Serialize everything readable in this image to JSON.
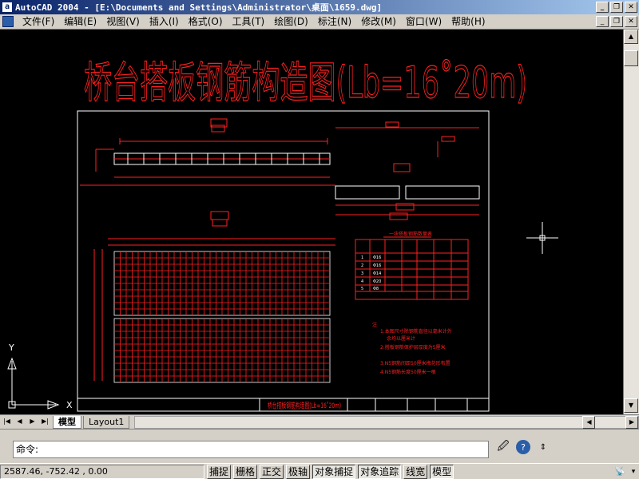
{
  "window": {
    "title": "AutoCAD 2004 - [E:\\Documents and Settings\\Administrator\\桌面\\1659.dwg]",
    "app_icon": "autocad-icon"
  },
  "menu": [
    {
      "label": "文件(F)"
    },
    {
      "label": "编辑(E)"
    },
    {
      "label": "视图(V)"
    },
    {
      "label": "插入(I)"
    },
    {
      "label": "格式(O)"
    },
    {
      "label": "工具(T)"
    },
    {
      "label": "绘图(D)"
    },
    {
      "label": "标注(N)"
    },
    {
      "label": "修改(M)"
    },
    {
      "label": "窗口(W)"
    },
    {
      "label": "帮助(H)"
    }
  ],
  "drawing": {
    "big_title": "桥台搭板钢筋构造图(Lb=16˚20m)",
    "frame_title": "桥台搭板钢筋构造图(Lb=16˚20m)",
    "table_title": "一块搭板钢筋数量表",
    "notes": [
      "注",
      "1.本图尺寸除钢筋直径以毫米计外",
      "余均以厘米计",
      "2.搭板钢筋保护层厚度为5厘米",
      "3.N5钢筋间距50厘米梅花形布置",
      "4.N5钢筋长度50厘米一根"
    ],
    "table_rows": [
      {
        "no": "1",
        "d": "Φ16"
      },
      {
        "no": "2",
        "d": "Φ16"
      },
      {
        "no": "3",
        "d": "Φ14"
      },
      {
        "no": "4",
        "d": "Φ20"
      },
      {
        "no": "5",
        "d": "Φ8"
      }
    ],
    "ucs_y": "Y",
    "ucs_x": "X"
  },
  "tabs": {
    "model": "模型",
    "layout1": "Layout1"
  },
  "command": {
    "prompt": "命令:"
  },
  "status": {
    "coords": "2587.46, -752.42 , 0.00",
    "toggles": [
      {
        "label": "捕捉",
        "active": false
      },
      {
        "label": "栅格",
        "active": false
      },
      {
        "label": "正交",
        "active": false
      },
      {
        "label": "极轴",
        "active": false
      },
      {
        "label": "对象捕捉",
        "active": true
      },
      {
        "label": "对象追踪",
        "active": true
      },
      {
        "label": "线宽",
        "active": false
      },
      {
        "label": "模型",
        "active": true
      }
    ]
  },
  "colors": {
    "drawing_red": "#ff2020",
    "drawing_white": "#ffffff",
    "canvas_bg": "#000000"
  }
}
